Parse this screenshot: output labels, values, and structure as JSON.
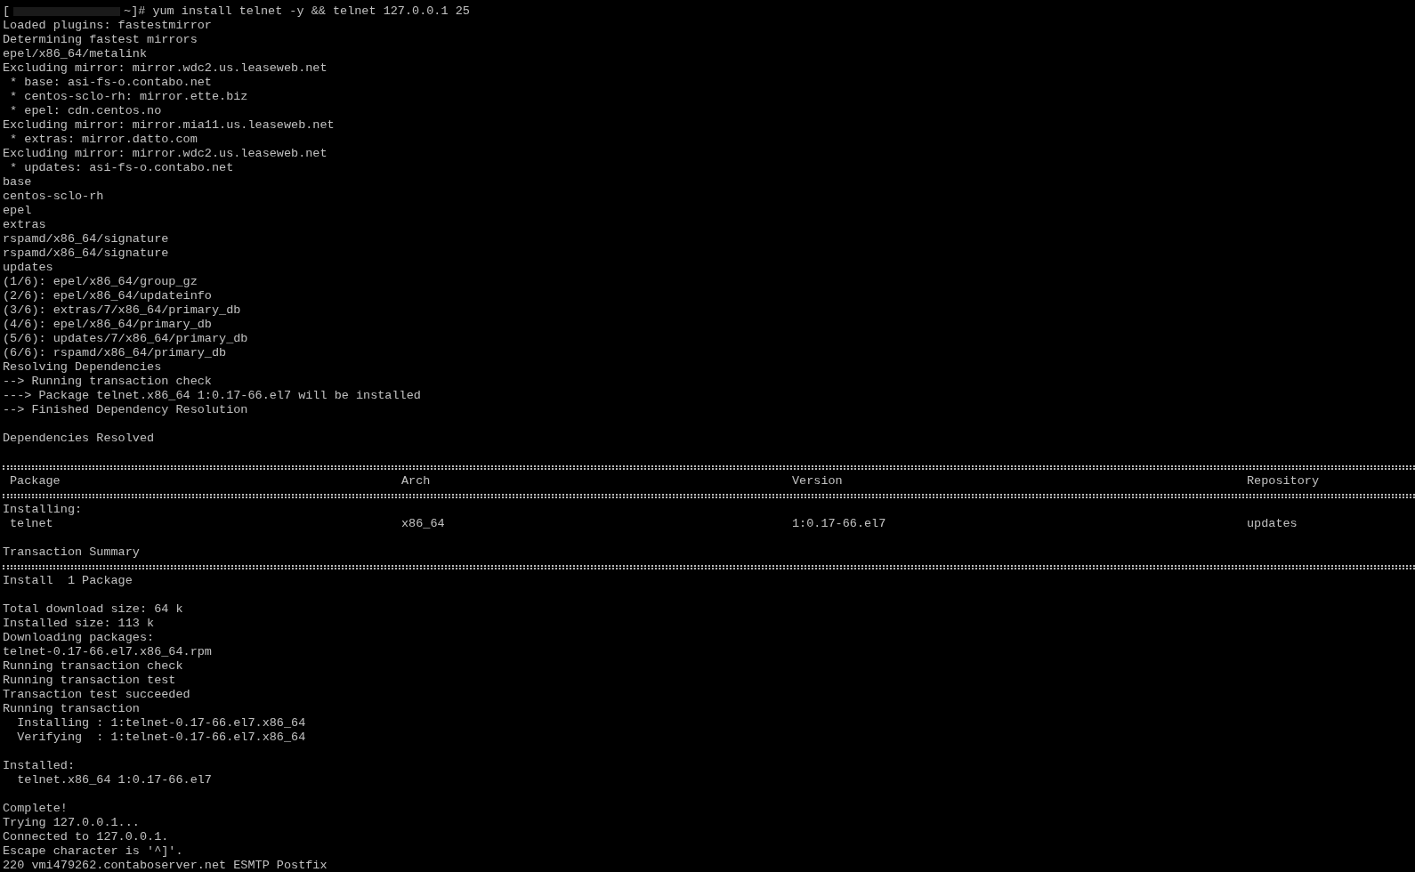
{
  "terminal": {
    "prompt": {
      "open": "[",
      "close": "~]#",
      "command": "yum install telnet -y && telnet 127.0.0.1 25"
    },
    "lines": [
      {
        "kind": "text",
        "text": "Loaded plugins: fastestmirror"
      },
      {
        "kind": "text",
        "text": "Determining fastest mirrors"
      },
      {
        "kind": "text",
        "text": "epel/x86_64/metalink"
      },
      {
        "kind": "text",
        "text": "Excluding mirror: mirror.wdc2.us.leaseweb.net"
      },
      {
        "kind": "text",
        "text": " * base: asi-fs-o.contabo.net"
      },
      {
        "kind": "text",
        "text": " * centos-sclo-rh: mirror.ette.biz"
      },
      {
        "kind": "text",
        "text": " * epel: cdn.centos.no"
      },
      {
        "kind": "text",
        "text": "Excluding mirror: mirror.mia11.us.leaseweb.net"
      },
      {
        "kind": "text",
        "text": " * extras: mirror.datto.com"
      },
      {
        "kind": "text",
        "text": "Excluding mirror: mirror.wdc2.us.leaseweb.net"
      },
      {
        "kind": "text",
        "text": " * updates: asi-fs-o.contabo.net"
      },
      {
        "kind": "text",
        "text": "base"
      },
      {
        "kind": "text",
        "text": "centos-sclo-rh"
      },
      {
        "kind": "text",
        "text": "epel"
      },
      {
        "kind": "text",
        "text": "extras"
      },
      {
        "kind": "text",
        "text": "rspamd/x86_64/signature"
      },
      {
        "kind": "text",
        "text": "rspamd/x86_64/signature"
      },
      {
        "kind": "text",
        "text": "updates"
      },
      {
        "kind": "text",
        "text": "(1/6): epel/x86_64/group_gz"
      },
      {
        "kind": "text",
        "text": "(2/6): epel/x86_64/updateinfo"
      },
      {
        "kind": "text",
        "text": "(3/6): extras/7/x86_64/primary_db"
      },
      {
        "kind": "text",
        "text": "(4/6): epel/x86_64/primary_db"
      },
      {
        "kind": "text",
        "text": "(5/6): updates/7/x86_64/primary_db"
      },
      {
        "kind": "text",
        "text": "(6/6): rspamd/x86_64/primary_db"
      },
      {
        "kind": "text",
        "text": "Resolving Dependencies"
      },
      {
        "kind": "text",
        "text": "--> Running transaction check"
      },
      {
        "kind": "text",
        "text": "---> Package telnet.x86_64 1:0.17-66.el7 will be installed"
      },
      {
        "kind": "text",
        "text": "--> Finished Dependency Resolution"
      },
      {
        "kind": "blank"
      },
      {
        "kind": "text",
        "text": "Dependencies Resolved"
      },
      {
        "kind": "blank"
      },
      {
        "kind": "rule"
      },
      {
        "kind": "columns",
        "cells": [
          "Package",
          "Arch",
          "Version",
          "Repository"
        ]
      },
      {
        "kind": "rule"
      },
      {
        "kind": "text",
        "text": "Installing:"
      },
      {
        "kind": "columns",
        "cells": [
          "telnet",
          "x86_64",
          "1:0.17-66.el7",
          "updates"
        ]
      },
      {
        "kind": "blank"
      },
      {
        "kind": "text",
        "text": "Transaction Summary"
      },
      {
        "kind": "rule"
      },
      {
        "kind": "text",
        "text": "Install  1 Package"
      },
      {
        "kind": "blank"
      },
      {
        "kind": "text",
        "text": "Total download size: 64 k"
      },
      {
        "kind": "text",
        "text": "Installed size: 113 k"
      },
      {
        "kind": "text",
        "text": "Downloading packages:"
      },
      {
        "kind": "text",
        "text": "telnet-0.17-66.el7.x86_64.rpm"
      },
      {
        "kind": "text",
        "text": "Running transaction check"
      },
      {
        "kind": "text",
        "text": "Running transaction test"
      },
      {
        "kind": "text",
        "text": "Transaction test succeeded"
      },
      {
        "kind": "text",
        "text": "Running transaction"
      },
      {
        "kind": "text",
        "text": "  Installing : 1:telnet-0.17-66.el7.x86_64"
      },
      {
        "kind": "text",
        "text": "  Verifying  : 1:telnet-0.17-66.el7.x86_64"
      },
      {
        "kind": "blank"
      },
      {
        "kind": "text",
        "text": "Installed:"
      },
      {
        "kind": "text",
        "text": "  telnet.x86_64 1:0.17-66.el7"
      },
      {
        "kind": "blank"
      },
      {
        "kind": "text",
        "text": "Complete!"
      },
      {
        "kind": "text",
        "text": "Trying 127.0.0.1..."
      },
      {
        "kind": "text",
        "text": "Connected to 127.0.0.1."
      },
      {
        "kind": "text",
        "text": "Escape character is '^]'."
      },
      {
        "kind": "text",
        "text": "220 vmi479262.contaboserver.net ESMTP Postfix"
      }
    ]
  }
}
